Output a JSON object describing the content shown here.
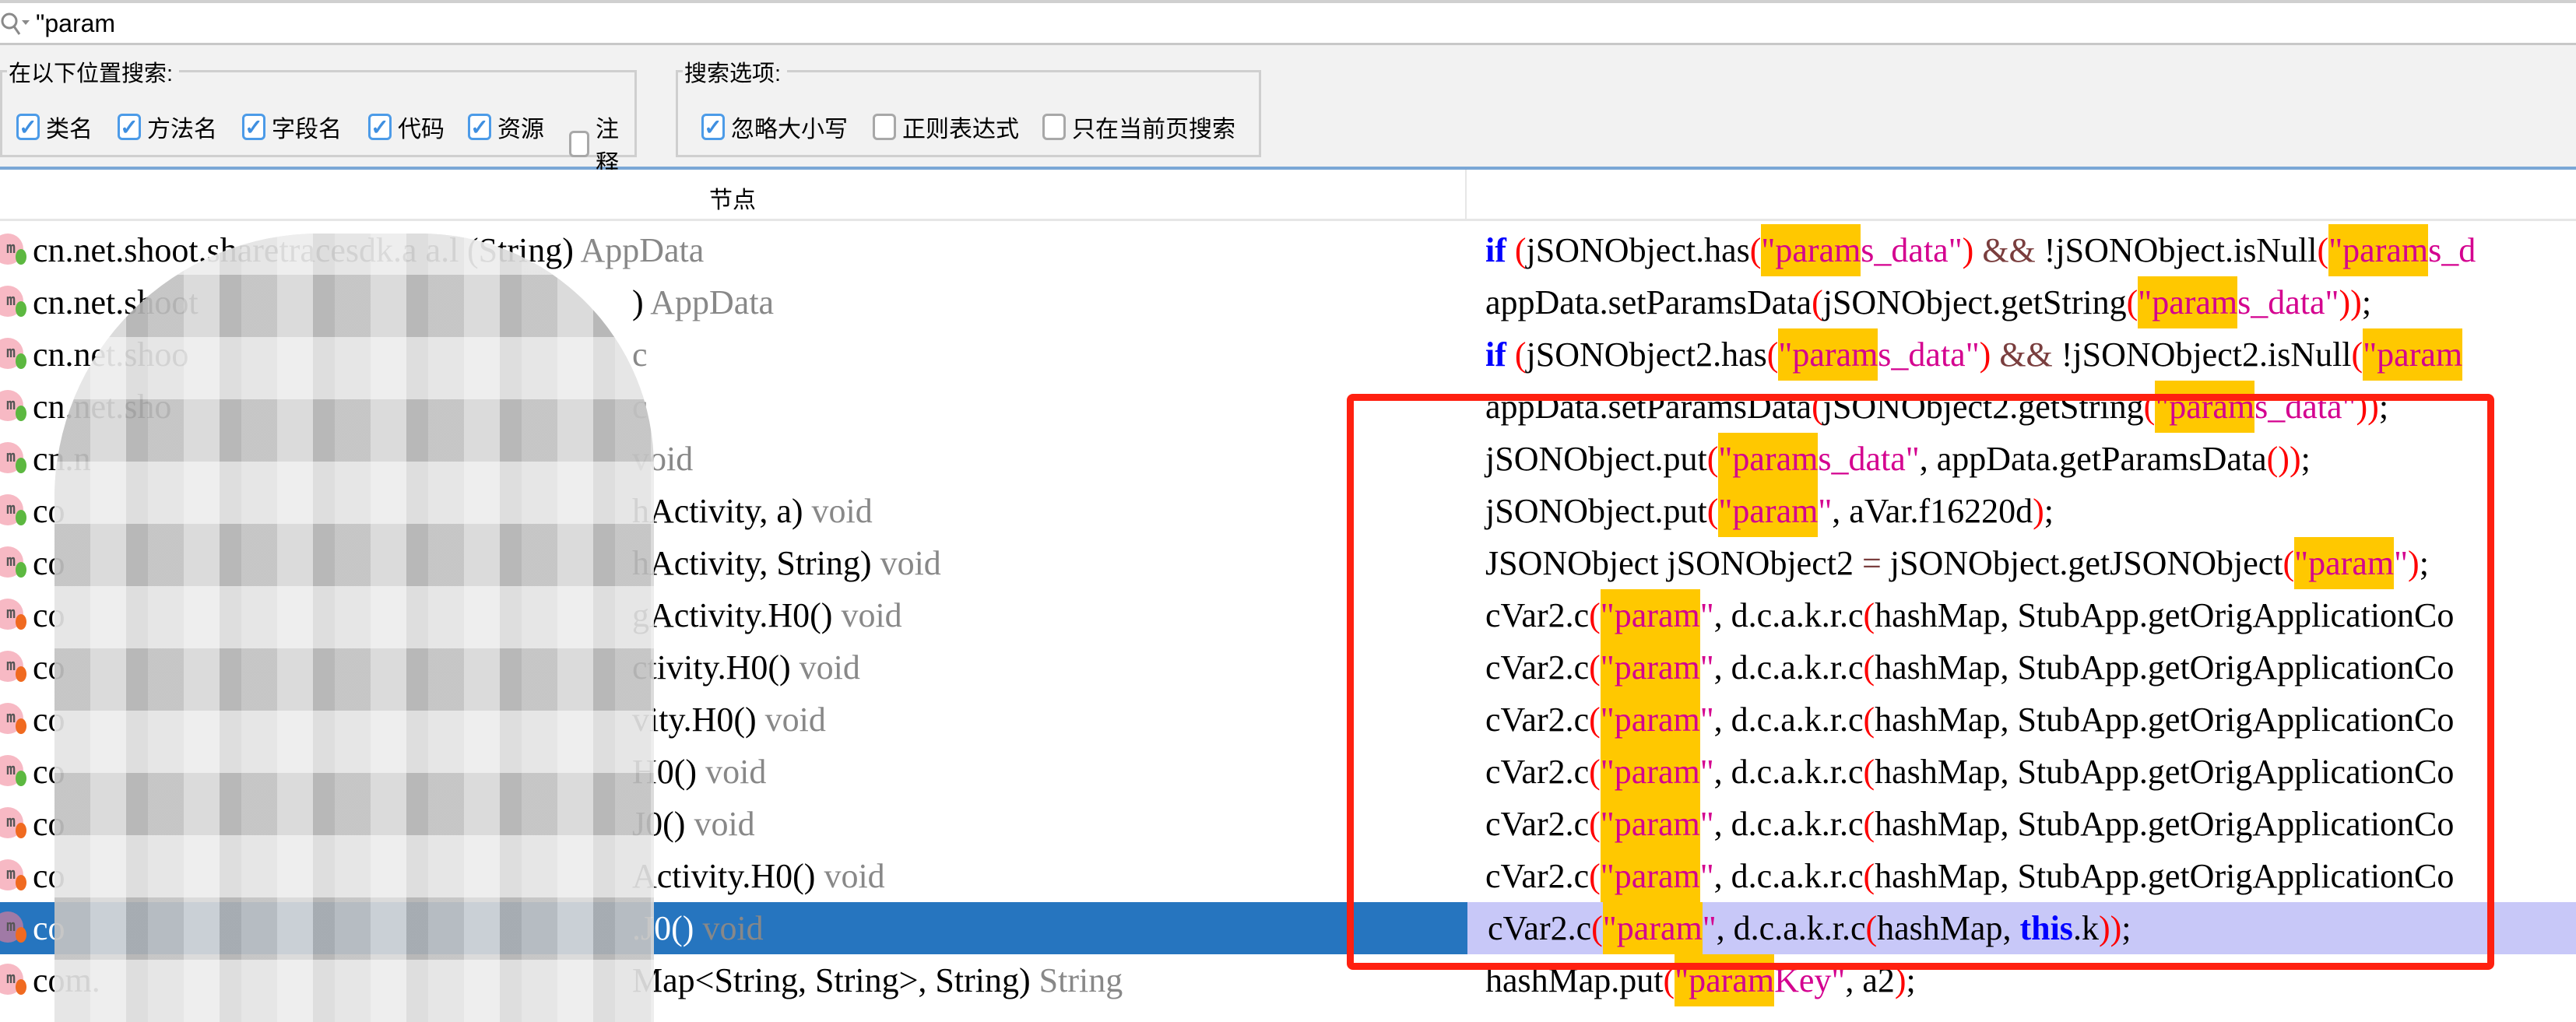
{
  "search": {
    "value": "\"param",
    "icon": "search-dropdown-icon"
  },
  "options": {
    "location_group": {
      "label": "在以下位置搜索:",
      "items": [
        {
          "label": "类名",
          "checked": true
        },
        {
          "label": "方法名",
          "checked": true
        },
        {
          "label": "字段名",
          "checked": true
        },
        {
          "label": "代码",
          "checked": true
        },
        {
          "label": "资源",
          "checked": true
        },
        {
          "label": "注释",
          "checked": false
        }
      ]
    },
    "search_group": {
      "label": "搜索选项:",
      "items": [
        {
          "label": "忽略大小写",
          "checked": true
        },
        {
          "label": "正则表达式",
          "checked": false
        },
        {
          "label": "只在当前页搜索",
          "checked": false
        }
      ]
    }
  },
  "table": {
    "header_node": "节点",
    "selected_index": 13,
    "colors": {
      "selected_left": "#2675bf",
      "selected_right": "#c8c8f8",
      "highlight": "#ffc800",
      "annotation_box": "#ff2010"
    },
    "rows": [
      {
        "icon": "method-icon",
        "dot": "#5cb840",
        "prefix": "cn.net.shoot.sharetracesdk.a a.l",
        "suffix": "(String)",
        "type": "AppData",
        "redacted": false,
        "code": [
          [
            "kw",
            "if"
          ],
          [
            "t",
            " "
          ],
          [
            "p",
            "("
          ],
          [
            "t",
            "jSONObject.has"
          ],
          [
            "p",
            "("
          ],
          [
            "hl",
            "\"param"
          ],
          [
            "s",
            "s_data\""
          ],
          [
            "p",
            ")"
          ],
          [
            "t",
            " "
          ],
          [
            "op",
            "&&"
          ],
          [
            "t",
            " !jSONObject.isNull"
          ],
          [
            "p",
            "("
          ],
          [
            "hl",
            "\"param"
          ],
          [
            "s",
            "s_d"
          ]
        ]
      },
      {
        "icon": "method-icon",
        "dot": "#5cb840",
        "prefix": "cn.net.shoot",
        "suffix": ")",
        "type": "AppData",
        "redacted": true,
        "code": [
          [
            "t",
            "appData.setParamsData"
          ],
          [
            "p",
            "("
          ],
          [
            "t",
            "jSONObject.getString"
          ],
          [
            "p",
            "("
          ],
          [
            "hl",
            "\"param"
          ],
          [
            "s",
            "s_data\""
          ],
          [
            "p",
            "))"
          ],
          [
            "t",
            ";"
          ]
        ]
      },
      {
        "icon": "method-icon",
        "dot": "#5cb840",
        "prefix": "cn.net.shoo",
        "suffix": "",
        "type": "c",
        "redacted": true,
        "code": [
          [
            "kw",
            "if"
          ],
          [
            "t",
            " "
          ],
          [
            "p",
            "("
          ],
          [
            "t",
            "jSONObject2.has"
          ],
          [
            "p",
            "("
          ],
          [
            "hl",
            "\"param"
          ],
          [
            "s",
            "s_data\""
          ],
          [
            "p",
            ")"
          ],
          [
            "t",
            " "
          ],
          [
            "op",
            "&&"
          ],
          [
            "t",
            " !jSONObject2.isNull"
          ],
          [
            "p",
            "("
          ],
          [
            "hl",
            "\"param"
          ]
        ]
      },
      {
        "icon": "method-icon",
        "dot": "#5cb840",
        "prefix": "cn.net.sho",
        "suffix": "",
        "type": "c",
        "redacted": true,
        "code": [
          [
            "t",
            "appData.setParamsData"
          ],
          [
            "p",
            "("
          ],
          [
            "t",
            "jSONObject2.getString"
          ],
          [
            "p",
            "("
          ],
          [
            "hl",
            "\"param"
          ],
          [
            "s",
            "s_data\""
          ],
          [
            "p",
            "))"
          ],
          [
            "t",
            ";"
          ]
        ]
      },
      {
        "icon": "method-icon",
        "dot": "#5cb840",
        "prefix": "cn.n",
        "suffix": "",
        "type": "void",
        "redacted": true,
        "code": [
          [
            "t",
            "jSONObject.put"
          ],
          [
            "p",
            "("
          ],
          [
            "hl",
            "\"param"
          ],
          [
            "s",
            "s_data\""
          ],
          [
            "t",
            ", appData.getParamsData"
          ],
          [
            "p",
            "())"
          ],
          [
            "t",
            ";"
          ]
        ]
      },
      {
        "icon": "method-icon",
        "dot": "#5cb840",
        "prefix": "co",
        "suffix": "hActivity, a)",
        "type": "void",
        "redacted": true,
        "code": [
          [
            "t",
            "jSONObject.put"
          ],
          [
            "p",
            "("
          ],
          [
            "hl",
            "\"param"
          ],
          [
            "s",
            "\""
          ],
          [
            "t",
            ", aVar.f16220d"
          ],
          [
            "p",
            ")"
          ],
          [
            "t",
            ";"
          ]
        ]
      },
      {
        "icon": "method-icon",
        "dot": "#5cb840",
        "prefix": "co",
        "suffix": "hActivity, String)",
        "type": "void",
        "redacted": true,
        "code": [
          [
            "t",
            "JSONObject jSONObject2 "
          ],
          [
            "op",
            "="
          ],
          [
            "t",
            " jSONObject.getJSONObject"
          ],
          [
            "p",
            "("
          ],
          [
            "hl",
            "\"param"
          ],
          [
            "s",
            "\""
          ],
          [
            "p",
            ")"
          ],
          [
            "t",
            ";"
          ]
        ]
      },
      {
        "icon": "method-icon",
        "dot": "#f06a20",
        "prefix": "co",
        "suffix": "gActivity.H0()",
        "type": "void",
        "redacted": true,
        "code": [
          [
            "t",
            "cVar2.c"
          ],
          [
            "p",
            "("
          ],
          [
            "hl",
            "\"param"
          ],
          [
            "s",
            "\""
          ],
          [
            "t",
            ", d.c.a.k.r.c"
          ],
          [
            "p",
            "("
          ],
          [
            "t",
            "hashMap, StubApp.getOrigApplicationCo"
          ]
        ]
      },
      {
        "icon": "method-icon",
        "dot": "#f06a20",
        "prefix": "co",
        "suffix": "ctivity.H0()",
        "type": "void",
        "redacted": true,
        "code": [
          [
            "t",
            "cVar2.c"
          ],
          [
            "p",
            "("
          ],
          [
            "hl",
            "\"param"
          ],
          [
            "s",
            "\""
          ],
          [
            "t",
            ", d.c.a.k.r.c"
          ],
          [
            "p",
            "("
          ],
          [
            "t",
            "hashMap, StubApp.getOrigApplicationCo"
          ]
        ]
      },
      {
        "icon": "method-icon",
        "dot": "#f06a20",
        "prefix": "co",
        "suffix": "vity.H0()",
        "type": "void",
        "redacted": true,
        "code": [
          [
            "t",
            "cVar2.c"
          ],
          [
            "p",
            "("
          ],
          [
            "hl",
            "\"param"
          ],
          [
            "s",
            "\""
          ],
          [
            "t",
            ", d.c.a.k.r.c"
          ],
          [
            "p",
            "("
          ],
          [
            "t",
            "hashMap, StubApp.getOrigApplicationCo"
          ]
        ]
      },
      {
        "icon": "method-icon",
        "dot": "#5cb840",
        "prefix": "co",
        "suffix": "H0()",
        "type": "void",
        "redacted": true,
        "code": [
          [
            "t",
            "cVar2.c"
          ],
          [
            "p",
            "("
          ],
          [
            "hl",
            "\"param"
          ],
          [
            "s",
            "\""
          ],
          [
            "t",
            ", d.c.a.k.r.c"
          ],
          [
            "p",
            "("
          ],
          [
            "t",
            "hashMap, StubApp.getOrigApplicationCo"
          ]
        ]
      },
      {
        "icon": "method-icon",
        "dot": "#f06a20",
        "prefix": "co",
        "suffix": "J0()",
        "type": "void",
        "redacted": true,
        "code": [
          [
            "t",
            "cVar2.c"
          ],
          [
            "p",
            "("
          ],
          [
            "hl",
            "\"param"
          ],
          [
            "s",
            "\""
          ],
          [
            "t",
            ", d.c.a.k.r.c"
          ],
          [
            "p",
            "("
          ],
          [
            "t",
            "hashMap, StubApp.getOrigApplicationCo"
          ]
        ]
      },
      {
        "icon": "method-icon",
        "dot": "#f06a20",
        "prefix": "co",
        "suffix": "Activity.H0()",
        "type": "void",
        "redacted": true,
        "code": [
          [
            "t",
            "cVar2.c"
          ],
          [
            "p",
            "("
          ],
          [
            "hl",
            "\"param"
          ],
          [
            "s",
            "\""
          ],
          [
            "t",
            ", d.c.a.k.r.c"
          ],
          [
            "p",
            "("
          ],
          [
            "t",
            "hashMap, StubApp.getOrigApplicationCo"
          ]
        ]
      },
      {
        "icon": "method-icon",
        "dot": "#f06a20",
        "prefix": "co",
        "suffix": ".J0()",
        "type": "void",
        "redacted": true,
        "code": [
          [
            "t",
            "cVar2.c"
          ],
          [
            "p",
            "("
          ],
          [
            "hl",
            "\"param"
          ],
          [
            "s",
            "\""
          ],
          [
            "t",
            ", d.c.a.k.r.c"
          ],
          [
            "p",
            "("
          ],
          [
            "t",
            "hashMap, "
          ],
          [
            "kw",
            "this"
          ],
          [
            "t",
            ".k"
          ],
          [
            "p",
            "))"
          ],
          [
            "t",
            ";"
          ]
        ]
      },
      {
        "icon": "method-icon",
        "dot": "#f06a20",
        "prefix": "com.",
        "suffix": "Map<String, String>, String)",
        "type": "String",
        "redacted": true,
        "code": [
          [
            "t",
            "hashMap.put"
          ],
          [
            "p",
            "("
          ],
          [
            "hl",
            "\"param"
          ],
          [
            "s",
            "Key\""
          ],
          [
            "t",
            ", a2"
          ],
          [
            "p",
            ")"
          ],
          [
            "t",
            ";"
          ]
        ]
      }
    ]
  }
}
